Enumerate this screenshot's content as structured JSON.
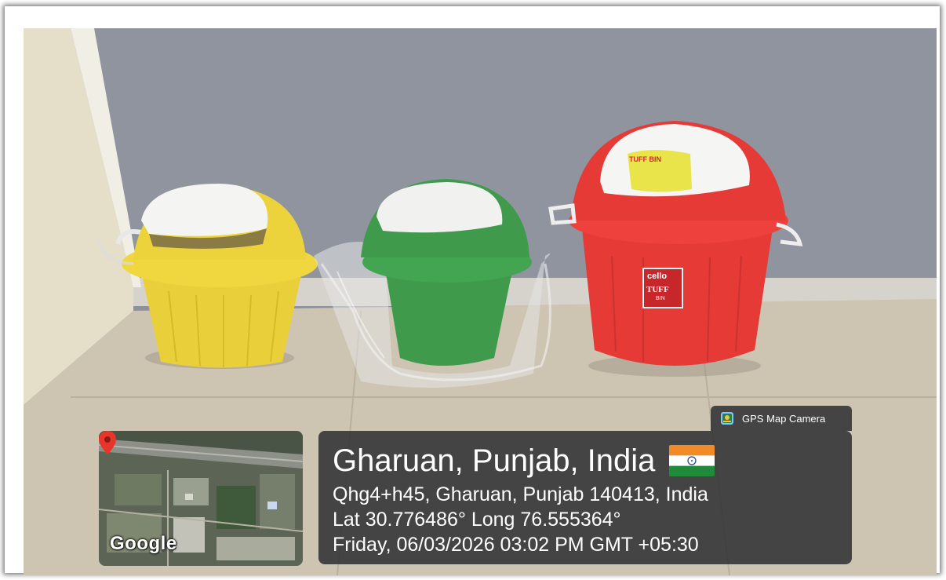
{
  "overlay": {
    "app_badge": "GPS Map Camera",
    "map_logo": "Google",
    "location_title": "Gharuan, Punjab, India",
    "flag_icon": "india-flag-icon",
    "address": "Qhg4+h45, Gharuan, Punjab 140413, India",
    "coordinates": "Lat 30.776486° Long 76.555364°",
    "datetime": "Friday, 06/03/2026 03:02 PM GMT +05:30"
  },
  "bins": {
    "red_bin_brand": "cello",
    "red_bin_label": "TUFF",
    "red_bin_sublabel": "BIN",
    "red_lid_label": "TUFF BIN"
  },
  "colors": {
    "wall": "#8d929c",
    "floor": "#cfc6b4",
    "yellow_bin": "#ecd33c",
    "green_bin": "#3f9a4c",
    "red_bin": "#e53a36",
    "overlay_bg": "#26282c"
  }
}
